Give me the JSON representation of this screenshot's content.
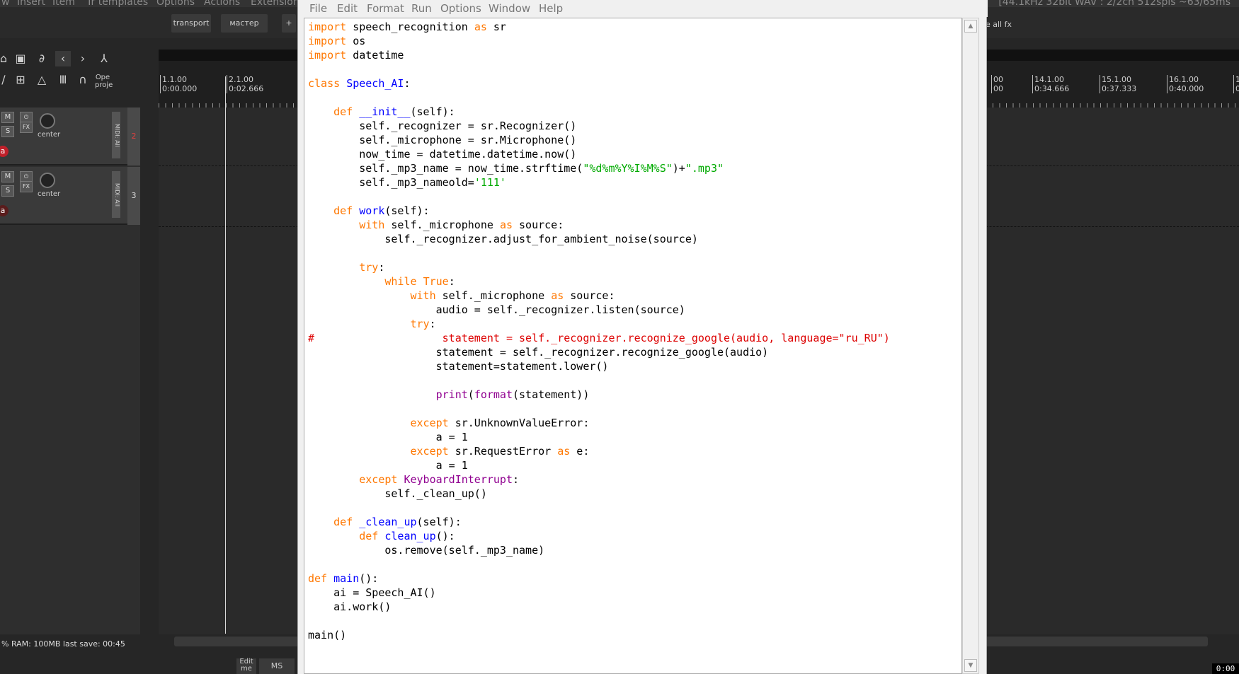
{
  "daw": {
    "menu": [
      "w",
      "Insert",
      "Item",
      "Tr templates",
      "Options",
      "Actions",
      "Extensions"
    ],
    "status_top": "[44.1kHz 32bit WAV : 2/2ch 512spls ~63/65ms",
    "tabs": [
      "transport",
      "мастер",
      "+"
    ],
    "toolbar_text": "Ope proje",
    "right_label": "e all fx",
    "ruler_marks": [
      {
        "bar": "1.1.00",
        "time": "0:00.000"
      },
      {
        "bar": "2.1.00",
        "time": "0:02.666"
      },
      {
        "bar": "00",
        "time": "00"
      },
      {
        "bar": "14.1.00",
        "time": "0:34.666"
      },
      {
        "bar": "15.1.00",
        "time": "0:37.333"
      },
      {
        "bar": "16.1.00",
        "time": "0:40.000"
      },
      {
        "bar": "1",
        "time": "0"
      }
    ],
    "tracks": [
      {
        "mute": "M",
        "solo": "S",
        "fx": "FX",
        "pan": "center",
        "midi": "MIDI: All",
        "number": "2",
        "rec": "a"
      },
      {
        "mute": "M",
        "solo": "S",
        "fx": "FX",
        "pan": "center",
        "midi": "MIDI: All",
        "number": "3",
        "rec": "a"
      }
    ],
    "status": "% RAM: 100MB  last save: 00:45",
    "bottom_buttons": [
      "Edit me",
      "MS"
    ],
    "time_display": "0:00"
  },
  "editor": {
    "menu": [
      "File",
      "Edit",
      "Format",
      "Run",
      "Options",
      "Window",
      "Help"
    ],
    "scroll_up": "▲",
    "scroll_down": "▼",
    "code_lines": [
      "import speech_recognition as sr",
      "import os",
      "import datetime",
      "",
      "class Speech_AI:",
      "",
      "    def __init__(self):",
      "        self._recognizer = sr.Recognizer()",
      "        self._microphone = sr.Microphone()",
      "        now_time = datetime.datetime.now()",
      "        self._mp3_name = now_time.strftime(\"%d%m%Y%I%M%S\")+\".mp3\"",
      "        self._mp3_nameold='111'",
      "",
      "    def work(self):",
      "        with self._microphone as source:",
      "            self._recognizer.adjust_for_ambient_noise(source)",
      "",
      "        try:",
      "            while True:",
      "                with self._microphone as source:",
      "                    audio = self._recognizer.listen(source)",
      "                try:",
      "#                    statement = self._recognizer.recognize_google(audio, language=\"ru_RU\")",
      "                    statement = self._recognizer.recognize_google(audio)",
      "                    statement=statement.lower()",
      "",
      "                    print(format(statement))",
      "",
      "                except sr.UnknownValueError:",
      "                    a = 1",
      "                except sr.RequestError as e:",
      "                    a = 1",
      "        except KeyboardInterrupt:",
      "            self._clean_up()",
      "",
      "    def _clean_up(self):",
      "        def clean_up():",
      "            os.remove(self._mp3_name)",
      "",
      "def main():",
      "    ai = Speech_AI()",
      "    ai.work()",
      "",
      "main()"
    ]
  }
}
